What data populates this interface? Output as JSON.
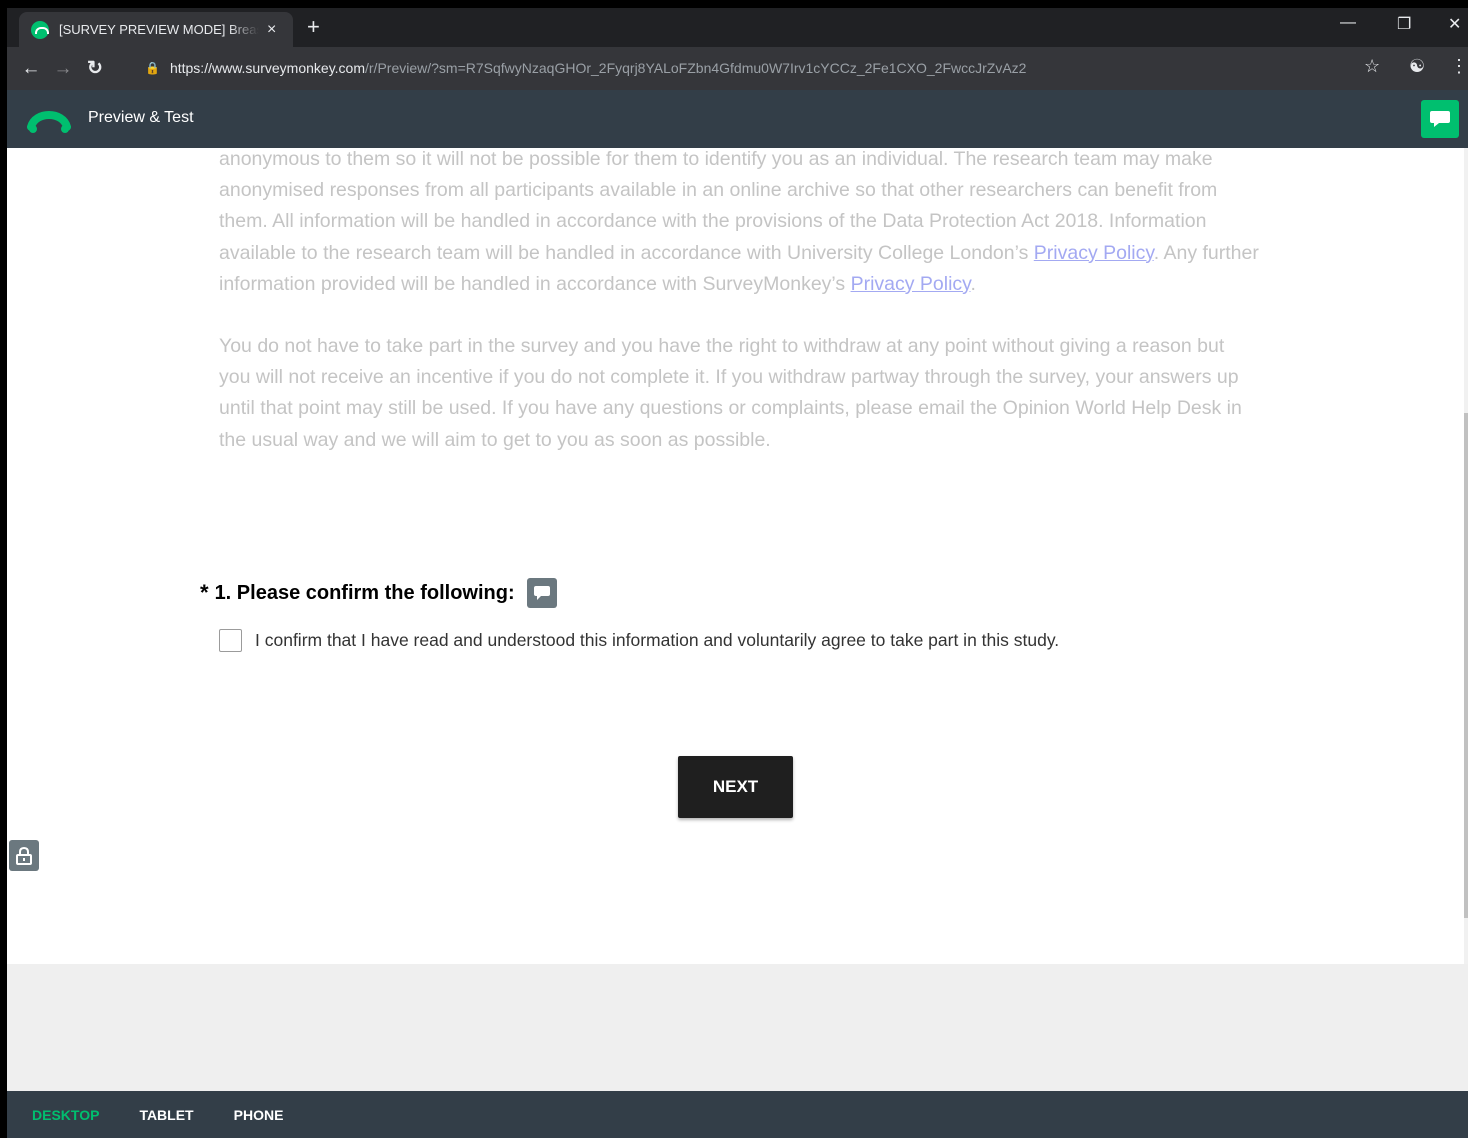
{
  "browser": {
    "tab_title": "[SURVEY PREVIEW MODE] Breast",
    "tab_close": "×",
    "new_tab": "+",
    "url_scheme": "https://",
    "url_host": "www.surveymonkey.com",
    "url_path": "/r/Preview/?sm=R7SqfwyNzaqGHOr_2Fyqrj8YALoFZbn4Gfdmu0W7Irv1cYCCz_2Fe1CXO_2FwccJrZvAz2"
  },
  "app": {
    "title": "Preview & Test"
  },
  "intro": {
    "p1_text1": "anonymous to them so it will not be possible for them to identify you as an individual. The research team may make anonymised responses from all participants available in an online archive so that other researchers can benefit from them. All information will be handled in accordance with the provisions of the Data Protection Act 2018. Information available to the research team will be handled in accordance with University College London’s ",
    "p1_link1": "Privacy Policy",
    "p1_text2": ". Any further information provided will be handled in accordance with SurveyMonkey’s ",
    "p1_link2": "Privacy Policy",
    "p1_text3": ".",
    "p2": "You do not have to take part in the survey and you have the right to withdraw at any point without giving a reason but you will not receive an incentive if you do not complete it. If you withdraw partway through the survey, your answers up until that point may still be used. If you have any questions or complaints, please email the Opinion World Help Desk in the usual way and we will aim to get to you as soon as possible."
  },
  "question": {
    "required_marker": "*",
    "title": "1. Please confirm the following:",
    "option_label": "I confirm that I have read and understood this information and voluntarily agree to take part in this study.",
    "checked": false
  },
  "buttons": {
    "next": "NEXT"
  },
  "footer": {
    "modes": [
      "DESKTOP",
      "TABLET",
      "PHONE"
    ],
    "active_mode": "DESKTOP"
  },
  "colors": {
    "brand_green": "#00bf6f",
    "header_bg": "#333e48"
  }
}
